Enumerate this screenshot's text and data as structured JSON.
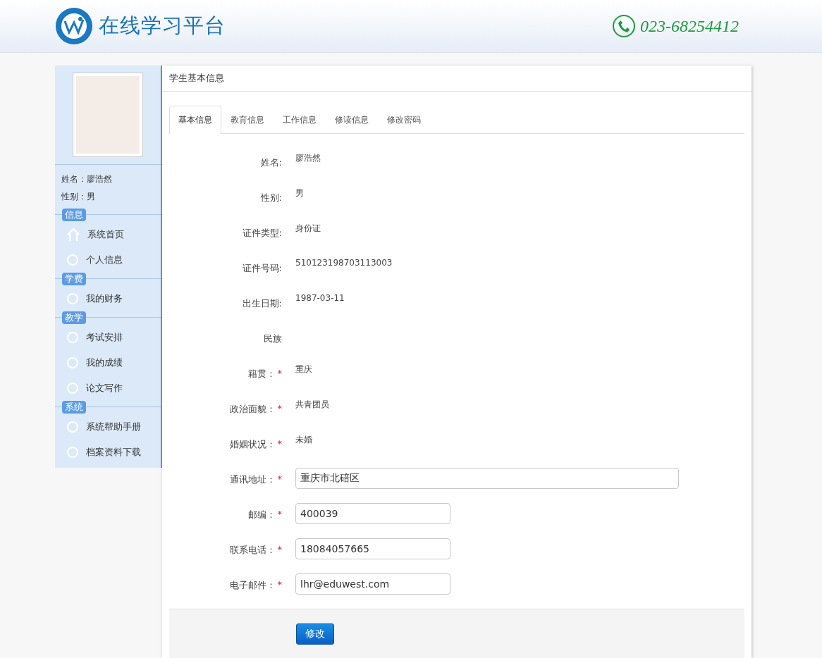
{
  "header": {
    "title": "在线学习平台",
    "phone": "023-68254412"
  },
  "sidebar": {
    "profile": [
      {
        "label": "姓名：",
        "value": "廖浩然"
      },
      {
        "label": "性别：",
        "value": "男"
      }
    ],
    "sections": [
      {
        "title": "信息",
        "items": [
          {
            "label": "系统首页",
            "kind": "home"
          },
          {
            "label": "个人信息",
            "kind": "plain"
          }
        ]
      },
      {
        "title": "学费",
        "items": [
          {
            "label": "我的财务",
            "kind": "plain"
          }
        ]
      },
      {
        "title": "教学",
        "items": [
          {
            "label": "考试安排",
            "kind": "plain"
          },
          {
            "label": "我的成绩",
            "kind": "plain"
          },
          {
            "label": "论文写作",
            "kind": "plain"
          }
        ]
      },
      {
        "title": "系统",
        "items": [
          {
            "label": "系统帮助手册",
            "kind": "plain"
          },
          {
            "label": "档案资料下载",
            "kind": "plain"
          }
        ]
      }
    ]
  },
  "panel": {
    "title": "学生基本信息",
    "tabs": [
      {
        "label": "基本信息",
        "selected": true
      },
      {
        "label": "教育信息",
        "selected": false
      },
      {
        "label": "工作信息",
        "selected": false
      },
      {
        "label": "修读信息",
        "selected": false
      },
      {
        "label": "修改密码",
        "selected": false
      }
    ],
    "fields": [
      {
        "kind": "text",
        "label": "姓名:",
        "value": "廖浩然"
      },
      {
        "kind": "text",
        "label": "性别:",
        "value": "男"
      },
      {
        "kind": "text",
        "label": "证件类型:",
        "value": "身份证"
      },
      {
        "kind": "text",
        "label": "证件号码:",
        "value": "510123198703113003"
      },
      {
        "kind": "text",
        "label": "出生日期:",
        "value": "1987-03-11"
      },
      {
        "kind": "text",
        "label": "民族"
      },
      {
        "kind": "text",
        "label": "籍贯：",
        "required_mark": "*",
        "value": "重庆"
      },
      {
        "kind": "text",
        "label": "政治面貌：",
        "required_mark": "*",
        "value": "共青团员"
      },
      {
        "kind": "text",
        "label": "婚姻状况：",
        "required_mark": "*",
        "value": "未婚"
      },
      {
        "kind": "wide-input",
        "label": "通讯地址：",
        "required_mark": "*",
        "value": "重庆市北碚区"
      },
      {
        "kind": "input",
        "label": "邮编：",
        "required_mark": "*",
        "value": "400039"
      },
      {
        "kind": "input",
        "label": "联系电话：",
        "required_mark": "*",
        "value": "18084057665"
      },
      {
        "kind": "input",
        "label": "电子邮件：",
        "required_mark": "*",
        "value": "lhr@eduwest.com"
      }
    ],
    "submit": "修改"
  }
}
